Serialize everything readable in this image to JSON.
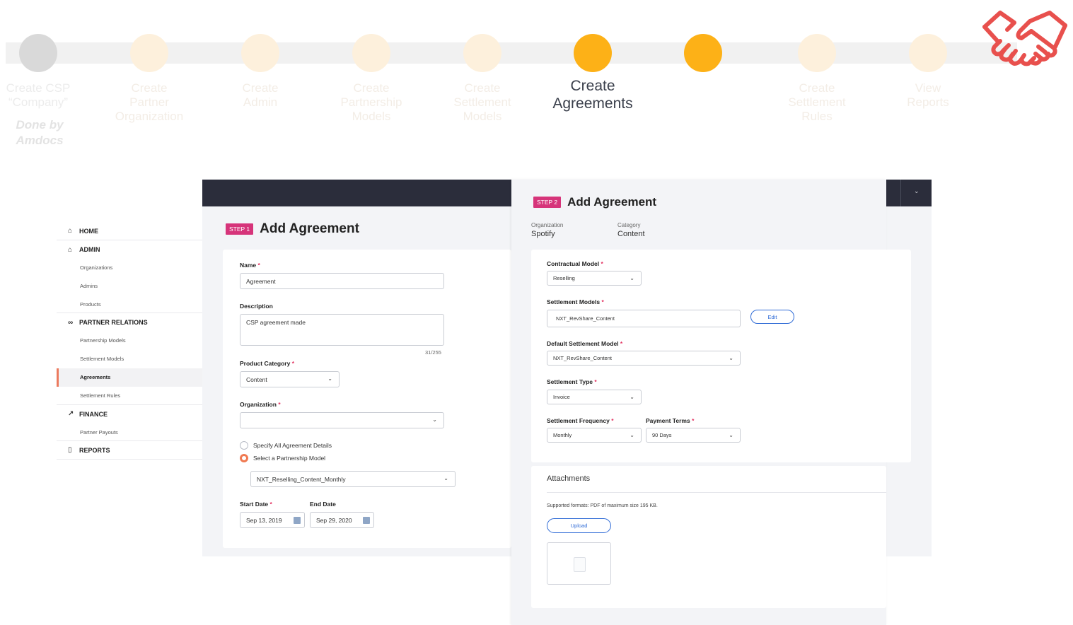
{
  "progress": {
    "steps": [
      {
        "label": "Create CSP\n“Company”",
        "state": "done"
      },
      {
        "label": "Create\nPartner\nOrganization",
        "state": "pending"
      },
      {
        "label": "Create\nAdmin",
        "state": "pending"
      },
      {
        "label": "Create\nPartnership\nModels",
        "state": "pending"
      },
      {
        "label": "Create\nSettlement\nModels",
        "state": "pending"
      },
      {
        "label": "Create\nAgreements",
        "state": "active"
      },
      {
        "label": "",
        "state": "active"
      },
      {
        "label": "Create\nSettlement\nRules",
        "state": "pending"
      },
      {
        "label": "View\nReports",
        "state": "pending"
      }
    ],
    "done_by": "Done by\nAmdocs",
    "colors": {
      "active": "#fdb117",
      "pending": "#fdf0dc",
      "done": "#d9d9d9",
      "logo": "#e8504d"
    },
    "logo_icon": "handshake-icon"
  },
  "sidebar": {
    "home": "HOME",
    "admin": "ADMIN",
    "admin_items": [
      "Organizations",
      "Admins",
      "Products"
    ],
    "partner_relations": "PARTNER RELATIONS",
    "partner_items": [
      "Partnership Models",
      "Settlement Models",
      "Agreements",
      "Settlement Rules"
    ],
    "finance": "FINANCE",
    "finance_items": [
      "Partner Payouts"
    ],
    "reports": "REPORTS",
    "active_item": "Agreements",
    "accent_color": "#ec7a5e"
  },
  "step1": {
    "badge": "STEP 1",
    "title": "Add Agreement",
    "name_label": "Name",
    "name_value": "Agreement",
    "description_label": "Description",
    "description_value": "CSP agreement made",
    "description_counter": "31/255",
    "product_category_label": "Product Category",
    "product_category_value": "Content",
    "organization_label": "Organization",
    "organization_value": "",
    "radio_specify": "Specify All Agreement Details",
    "radio_select": "Select a Partnership Model",
    "partnership_model_value": "NXT_Reselling_Content_Monthly",
    "start_date_label": "Start Date",
    "start_date_value": "Sep 13, 2019",
    "end_date_label": "End Date",
    "end_date_value": "Sep 29, 2020",
    "required_mark": "*"
  },
  "step2": {
    "badge": "STEP 2",
    "title": "Add Agreement",
    "organization_key": "Organization",
    "organization_value": "Spotify",
    "category_key": "Category",
    "category_value": "Content",
    "contractual_model_label": "Contractual Model",
    "contractual_model_value": "Reselling",
    "settlement_models_label": "Settlement Models",
    "settlement_models_value": "NXT_RevShare_Content",
    "edit_label": "Edit",
    "default_settlement_model_label": "Default Settlement Model",
    "default_settlement_model_value": "NXT_RevShare_Content",
    "settlement_type_label": "Settlement Type",
    "settlement_type_value": "Invoice",
    "settlement_frequency_label": "Settlement Frequency",
    "settlement_frequency_value": "Monthly",
    "payment_terms_label": "Payment Terms",
    "payment_terms_value": "90 Days",
    "attachments_title": "Attachments",
    "attachments_note": "Supported formats: PDF of maximum size 195 KB.",
    "upload_label": "Upload",
    "required_mark": "*"
  },
  "theme": {
    "topbar": "#2b2d3b",
    "badge": "#d6347a",
    "link": "#2f6bd6",
    "radio_on": "#f07a52"
  }
}
